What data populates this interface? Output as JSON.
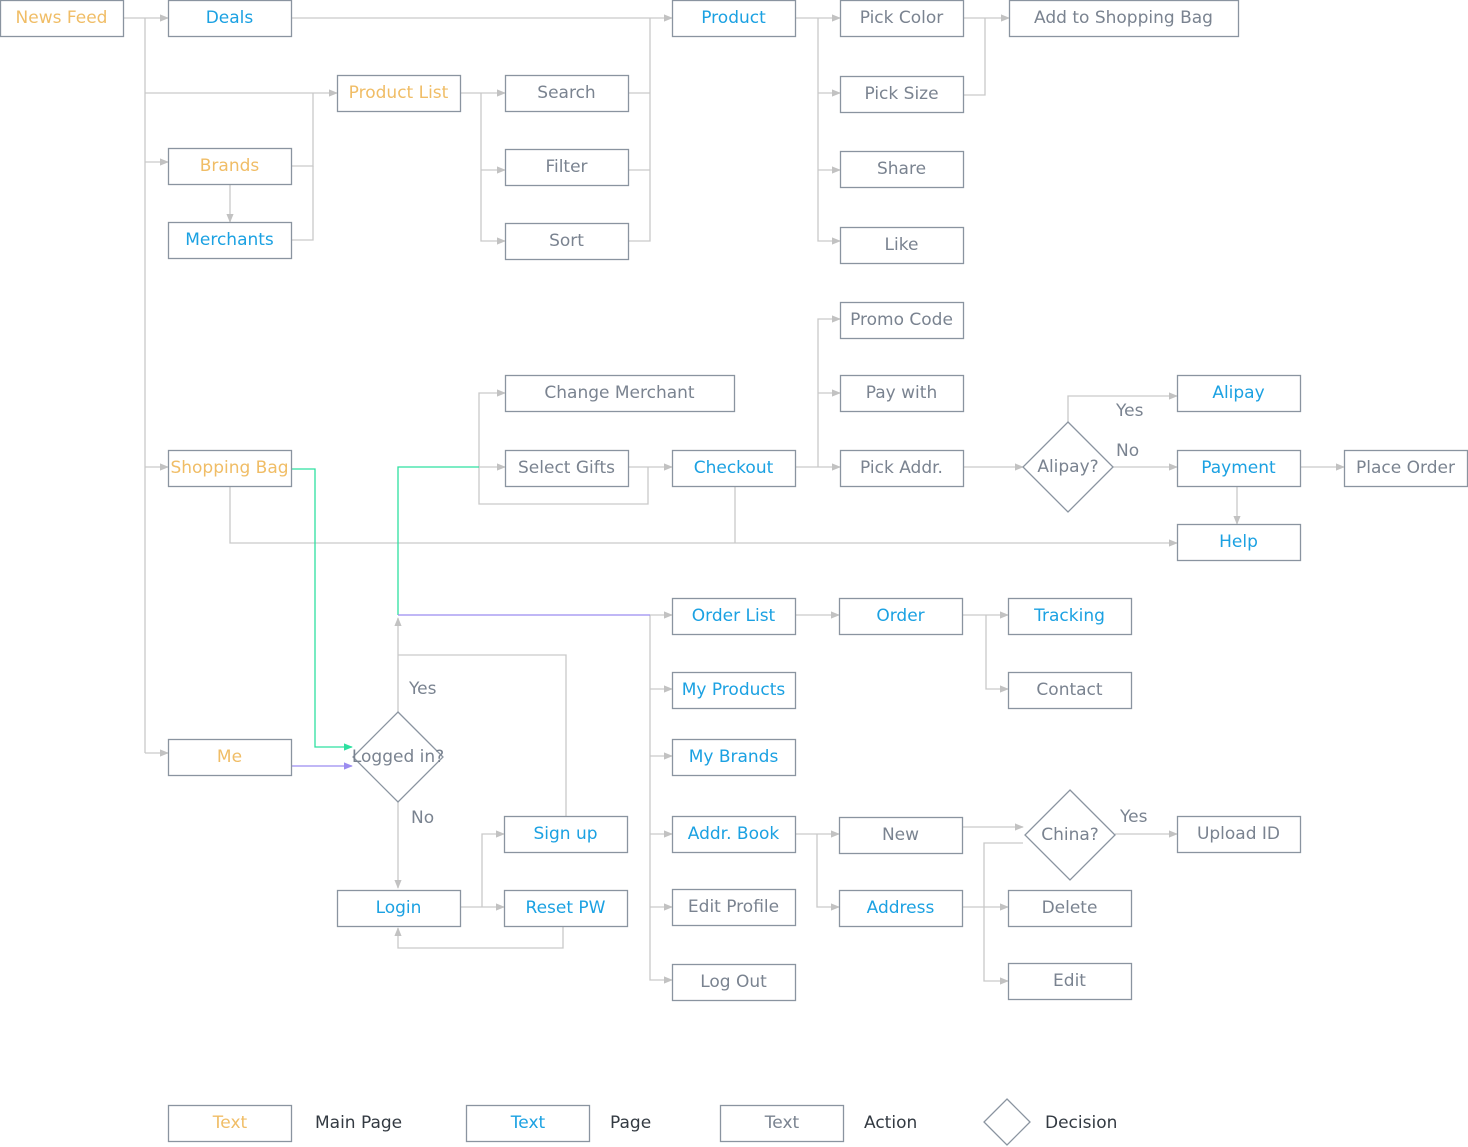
{
  "colors": {
    "main_page": "#f0bd66",
    "page": "#1ba1e2",
    "action": "#7a8390",
    "line": "#c9c9c9",
    "logged_in_path": "#2ee0a0",
    "me_path": "#9b8cf0"
  },
  "nodes": [
    {
      "id": "news-feed",
      "label": "News Feed",
      "type": "main_page"
    },
    {
      "id": "deals",
      "label": "Deals",
      "type": "page"
    },
    {
      "id": "product",
      "label": "Product",
      "type": "page"
    },
    {
      "id": "pick-color",
      "label": "Pick Color",
      "type": "action"
    },
    {
      "id": "add-to-shopping-bag",
      "label": "Add to Shopping Bag",
      "type": "action"
    },
    {
      "id": "product-list",
      "label": "Product List",
      "type": "main_page"
    },
    {
      "id": "search",
      "label": "Search",
      "type": "action"
    },
    {
      "id": "pick-size",
      "label": "Pick Size",
      "type": "action"
    },
    {
      "id": "brands",
      "label": "Brands",
      "type": "main_page"
    },
    {
      "id": "filter",
      "label": "Filter",
      "type": "action"
    },
    {
      "id": "share",
      "label": "Share",
      "type": "action"
    },
    {
      "id": "merchants",
      "label": "Merchants",
      "type": "page"
    },
    {
      "id": "sort",
      "label": "Sort",
      "type": "action"
    },
    {
      "id": "like",
      "label": "Like",
      "type": "action"
    },
    {
      "id": "promo-code",
      "label": "Promo Code",
      "type": "action"
    },
    {
      "id": "change-merchant",
      "label": "Change Merchant",
      "type": "action"
    },
    {
      "id": "pay-with",
      "label": "Pay with",
      "type": "action"
    },
    {
      "id": "alipay",
      "label": "Alipay",
      "type": "page"
    },
    {
      "id": "shopping-bag",
      "label": "Shopping Bag",
      "type": "main_page"
    },
    {
      "id": "select-gifts",
      "label": "Select Gifts",
      "type": "action"
    },
    {
      "id": "checkout",
      "label": "Checkout",
      "type": "page"
    },
    {
      "id": "pick-addr",
      "label": "Pick Addr.",
      "type": "action"
    },
    {
      "id": "alipay-decision",
      "label": "Alipay?",
      "type": "decision"
    },
    {
      "id": "payment",
      "label": "Payment",
      "type": "page"
    },
    {
      "id": "place-order",
      "label": "Place Order",
      "type": "action"
    },
    {
      "id": "help",
      "label": "Help",
      "type": "page"
    },
    {
      "id": "order-list",
      "label": "Order List",
      "type": "page"
    },
    {
      "id": "order",
      "label": "Order",
      "type": "page"
    },
    {
      "id": "tracking",
      "label": "Tracking",
      "type": "page"
    },
    {
      "id": "contact",
      "label": "Contact",
      "type": "action"
    },
    {
      "id": "my-products",
      "label": "My Products",
      "type": "page"
    },
    {
      "id": "me",
      "label": "Me",
      "type": "main_page"
    },
    {
      "id": "logged-in-decision",
      "label": "Logged in?",
      "type": "decision"
    },
    {
      "id": "my-brands",
      "label": "My Brands",
      "type": "page"
    },
    {
      "id": "sign-up",
      "label": "Sign up",
      "type": "page"
    },
    {
      "id": "addr-book",
      "label": "Addr. Book",
      "type": "page"
    },
    {
      "id": "new",
      "label": "New",
      "type": "action"
    },
    {
      "id": "china-decision",
      "label": "China?",
      "type": "decision"
    },
    {
      "id": "upload-id",
      "label": "Upload ID",
      "type": "action"
    },
    {
      "id": "login",
      "label": "Login",
      "type": "page"
    },
    {
      "id": "reset-pw",
      "label": "Reset PW",
      "type": "page"
    },
    {
      "id": "edit-profile",
      "label": "Edit Profile",
      "type": "action"
    },
    {
      "id": "address",
      "label": "Address",
      "type": "page"
    },
    {
      "id": "delete",
      "label": "Delete",
      "type": "action"
    },
    {
      "id": "log-out",
      "label": "Log Out",
      "type": "action"
    },
    {
      "id": "edit",
      "label": "Edit",
      "type": "action"
    }
  ],
  "edge_labels": {
    "alipay_yes": "Yes",
    "alipay_no": "No",
    "logged_in_yes": "Yes",
    "logged_in_no": "No",
    "china_yes": "Yes"
  },
  "legend": [
    {
      "sample": "Text",
      "label": "Main Page",
      "type": "main_page"
    },
    {
      "sample": "Text",
      "label": "Page",
      "type": "page"
    },
    {
      "sample": "Text",
      "label": "Action",
      "type": "action"
    },
    {
      "sample": "",
      "label": "Decision",
      "type": "decision"
    }
  ]
}
